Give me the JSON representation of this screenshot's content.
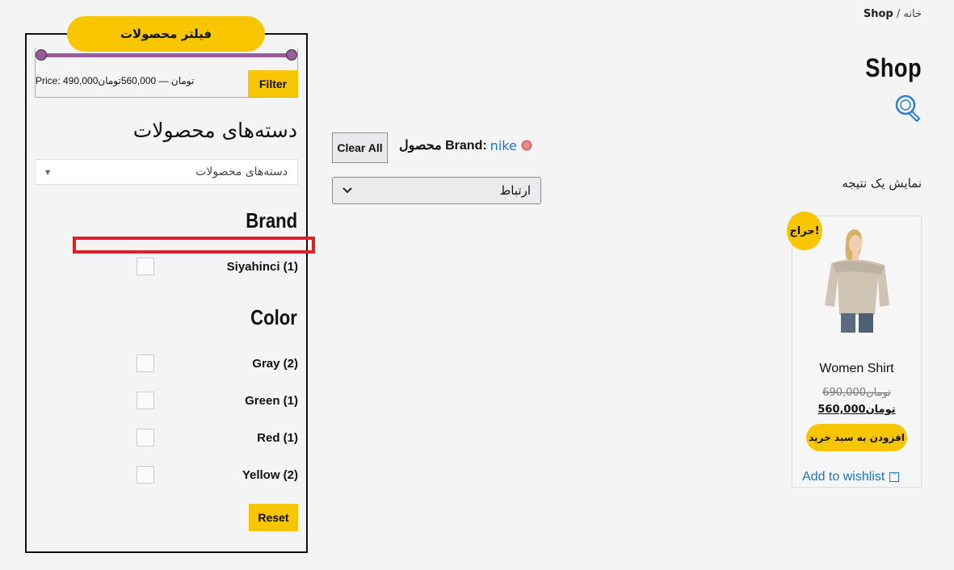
{
  "breadcrumb": {
    "home": "خانه",
    "separator": "/",
    "current": "Shop"
  },
  "page_title": "Shop",
  "active_filters": {
    "clear_label": "Clear All",
    "attribute_label": "محصول Brand:",
    "value": "nike"
  },
  "result_count": "نمایش یک نتیجه",
  "sort": {
    "selected": "ارتباط"
  },
  "product": {
    "badge": "حراج!",
    "name": "Women Shirt",
    "old_price": "690,000تومان",
    "new_price": "560,000تومان",
    "add_to_cart": "افزودن به سبد خرید",
    "wishlist": "Add to wishlist"
  },
  "sidebar": {
    "filter_title": "فیلتر محصولات",
    "price_label": "Price: 490,000تومان — 560,000تومان",
    "filter_button": "Filter",
    "categories_heading": "دسته‌های محصولات",
    "categories_select": "دسته‌های محصولات",
    "brand_heading": "Brand",
    "brands": [
      {
        "label": "Siyahinci (1)"
      }
    ],
    "color_heading": "Color",
    "colors": [
      {
        "label": "Gray (2)"
      },
      {
        "label": "Green (1)"
      },
      {
        "label": "Red (1)"
      },
      {
        "label": "Yellow (2)"
      }
    ],
    "reset_button": "Reset"
  },
  "colors": {
    "accent": "#f7c600",
    "slider": "#9b5a9a",
    "link": "#1a73c8",
    "highlight": "#e01f26"
  },
  "icons": [
    "search-icon",
    "remove-filter-icon",
    "chevron-down-icon",
    "wishlist-icon",
    "caret-down-icon"
  ]
}
